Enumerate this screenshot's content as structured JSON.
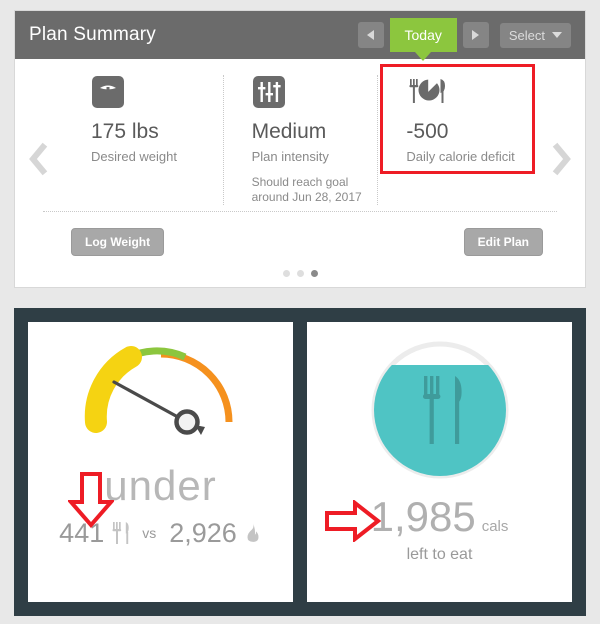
{
  "plan_card": {
    "header": {
      "title": "Plan Summary",
      "prev_icon": "triangle-left-icon",
      "next_icon": "triangle-right-icon",
      "today_label": "Today",
      "select_label": "Select",
      "caret_icon": "caret-down-icon",
      "bg_color": "#6b6b6b",
      "today_color": "#8cc63e"
    },
    "carousel": {
      "prev_icon": "chevron-left-icon",
      "next_icon": "chevron-right-icon",
      "dots": [
        {
          "active": false
        },
        {
          "active": false
        },
        {
          "active": true
        }
      ]
    },
    "stats": [
      {
        "icon": "weight-scale-icon",
        "value": "175 lbs",
        "label": "Desired weight",
        "sub": ""
      },
      {
        "icon": "sliders-icon",
        "value": "Medium",
        "label": "Plan intensity",
        "sub": "Should reach goal around Jun 28, 2017"
      },
      {
        "icon": "meal-pie-icon",
        "value": "-500",
        "label": "Daily calorie deficit",
        "sub": ""
      }
    ],
    "buttons": {
      "log_weight": "Log Weight",
      "edit_plan": "Edit Plan"
    }
  },
  "annotations": {
    "box_color": "#ee1c25",
    "box_target": "daily-calorie-deficit-stat",
    "arrow_down_target": "calories-eaten-value",
    "arrow_right_target": "calories-left-value"
  },
  "dashboard": {
    "frame_color": "#2f3e45",
    "gauge_tile": {
      "gauge": {
        "icon": "speedometer-gauge",
        "needle_angle_deg": 214,
        "segments": [
          {
            "name": "under",
            "color": "#f5d312",
            "active": true
          },
          {
            "name": "on-target",
            "color": "#8cc63e",
            "active": false
          },
          {
            "name": "over",
            "color": "#f5911e",
            "active": false
          }
        ]
      },
      "status_word": "under",
      "eaten_value": "441",
      "eaten_icon": "fork-knife-icon",
      "vs_label": "vs",
      "burned_value": "2,926",
      "burned_icon": "flame-icon"
    },
    "calories_tile": {
      "circle": {
        "icon": "fork-knife-circle-icon",
        "fill_color": "#4fc4c4",
        "track_color": "#ececec",
        "fill_percent": 82
      },
      "value": "1,985",
      "unit": "cals",
      "caption": "left to eat"
    }
  }
}
